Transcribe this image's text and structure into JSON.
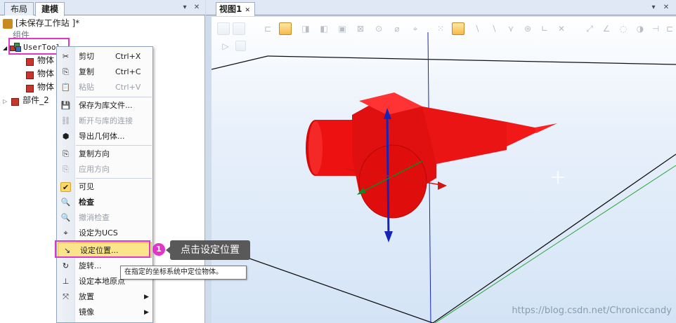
{
  "left_panel": {
    "tabs": [
      {
        "label": "布局"
      },
      {
        "label": "建模"
      }
    ],
    "pin_icon": "▾",
    "close_icon": "✕",
    "tree": {
      "station": "[未保存工作站 ]*",
      "group_header": "组件",
      "usertool": "UserTool",
      "children": [
        "物体",
        "物体",
        "物体"
      ],
      "part": "部件_2"
    }
  },
  "context_menu": {
    "items": [
      {
        "label": "剪切",
        "shortcut": "Ctrl+X",
        "icon": "✂",
        "enabled": true
      },
      {
        "label": "复制",
        "shortcut": "Ctrl+C",
        "icon": "⎘",
        "enabled": true
      },
      {
        "label": "粘贴",
        "shortcut": "Ctrl+V",
        "icon": "📋",
        "enabled": false
      },
      {
        "label": "保存为库文件...",
        "icon": "💾",
        "enabled": true
      },
      {
        "label": "断开与库的连接",
        "icon": "⛓",
        "enabled": false
      },
      {
        "label": "导出几何体...",
        "icon": "⬢",
        "enabled": true
      },
      {
        "label": "复制方向",
        "icon": "⎘",
        "enabled": true
      },
      {
        "label": "应用方向",
        "icon": "⎘",
        "enabled": false
      },
      {
        "label": "可见",
        "icon": "✔",
        "enabled": true
      },
      {
        "label": "检查",
        "icon": "🔍",
        "enabled": true,
        "bold": true
      },
      {
        "label": "撤消检查",
        "icon": "🔍",
        "enabled": false
      },
      {
        "label": "设定为UCS",
        "icon": "⌖",
        "enabled": true
      },
      {
        "label": "设定位置...",
        "icon": "↘",
        "enabled": true,
        "selected": true
      },
      {
        "label": "旋转...",
        "icon": "↻",
        "enabled": true
      },
      {
        "label": "设定本地原点",
        "icon": "⊥",
        "enabled": true
      },
      {
        "label": "放置",
        "icon": "⤧",
        "enabled": true,
        "submenu": "▶"
      },
      {
        "label": "镜像",
        "icon": "",
        "enabled": true,
        "submenu": "▶"
      }
    ]
  },
  "tooltip": "在指定的坐标系统中定位物体。",
  "callout": {
    "number": "1",
    "text": "点击设定位置"
  },
  "right_panel": {
    "tab": "视图1",
    "tab_close": "✕",
    "pin_icon": "▾",
    "close_icon": "✕"
  },
  "watermark": "https://blog.csdn.net/Chroniccandy",
  "colors": {
    "highlight": "#e236c8",
    "tool_red": "#ee1111",
    "axis_blue": "#1624b8",
    "axis_green": "#0c8a2a"
  }
}
